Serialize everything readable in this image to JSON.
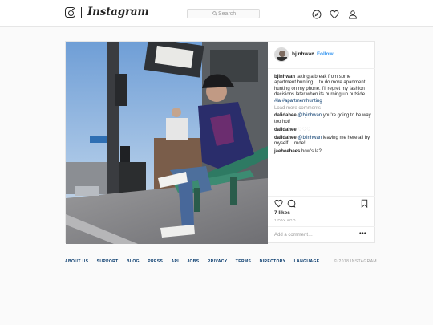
{
  "header": {
    "wordmark": "Instagram",
    "search_placeholder": "Search",
    "icons": [
      "instagram-logo-icon",
      "compass-icon",
      "heart-icon",
      "person-icon"
    ]
  },
  "post": {
    "username": "bjinhwan",
    "separator": "•",
    "follow_label": "Follow",
    "caption": {
      "user": "bjinhwan",
      "text": "taking a break from some apartment hunting… to do more apartment hunting on my phone. I'll regret my fashion decisions later when its burning up outside.",
      "hashtags": [
        "#la",
        "#apartmenthunting"
      ]
    },
    "load_more_label": "Load more comments",
    "comments": [
      {
        "user": "dalidahee",
        "mention": "@bjinhwan",
        "text": "you're going to be way too hot!"
      },
      {
        "user": "dalidahee",
        "mention": "",
        "text": "♡♡♡"
      },
      {
        "user": "dalidahee",
        "mention": "@bjinhwan",
        "text": "leaving me here all by myself… rude!"
      },
      {
        "user": "jaeheebees",
        "mention": "",
        "text": "how's la?"
      }
    ],
    "likes": "7 likes",
    "time_ago": "1 DAY AGO",
    "add_comment_placeholder": "Add a comment…",
    "more_label": "•••"
  },
  "footer": {
    "links": [
      "ABOUT US",
      "SUPPORT",
      "BLOG",
      "PRESS",
      "API",
      "JOBS",
      "PRIVACY",
      "TERMS",
      "DIRECTORY",
      "LANGUAGE"
    ],
    "copyright": "© 2018 INSTAGRAM"
  },
  "colors": {
    "link_blue": "#3897f0",
    "dark_link": "#003569",
    "muted": "#999999",
    "border": "#e6e6e6"
  }
}
